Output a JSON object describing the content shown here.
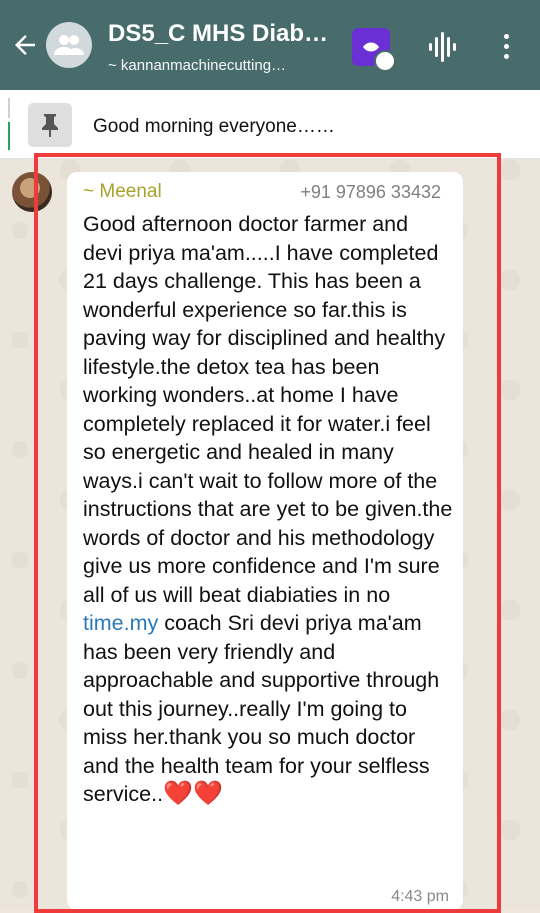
{
  "header": {
    "back_icon": "arrow-left-icon",
    "group_title": "DS5_C MHS Diab…",
    "subtitle": "~ kannanmachinecutting…",
    "app_badge": "app-badge-icon",
    "audio_icon": "audio-wave-icon",
    "menu_icon": "more-vert-icon"
  },
  "pinned": {
    "icon": "pin-icon",
    "text": "Good morning everyone……"
  },
  "message": {
    "sender_name": "~ Meenal",
    "sender_phone": "+91 97896 33432",
    "body_part1": "Good afternoon doctor farmer and devi priya ma'am.....I have completed 21 days challenge. This has been  a wonderful experience so far.this is paving way for disciplined and healthy lifestyle.the detox  tea has been working wonders..at home I have completely replaced it for water.i feel so energetic and healed in many ways.i can't wait to follow more of the instructions that are yet to be given.the words of doctor and his methodology give us more confidence and I'm sure all of us will beat diabiaties in no ",
    "link_text": "time.my",
    "body_part2": " coach Sri devi priya ma'am has been very friendly and approachable and supportive through out this journey..really I'm going to miss her.thank you so much doctor and the health team for your selfless service..",
    "hearts": "❤️❤️",
    "time": "4:43 pm"
  },
  "colors": {
    "header_bg": "#476c6b",
    "highlight_border": "#ef3b3b",
    "sender_name": "#a6a22b",
    "link": "#2a79b9"
  }
}
